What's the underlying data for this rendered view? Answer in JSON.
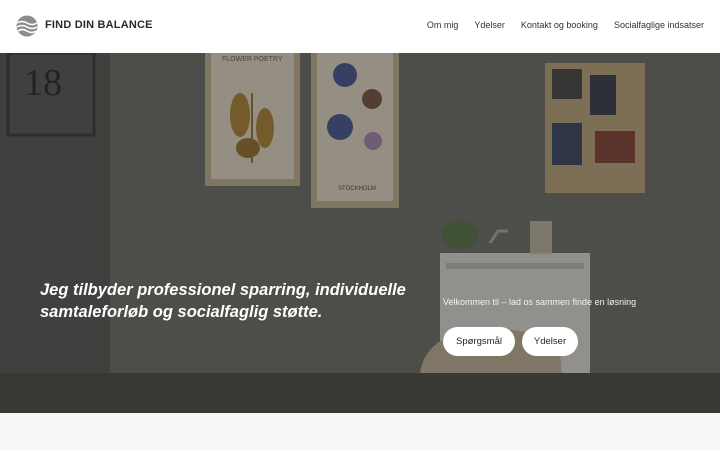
{
  "header": {
    "brand": "FIND DIN BALANCE",
    "nav": [
      "Om mig",
      "Ydelser",
      "Kontakt og booking",
      "Socialfaglige indsatser"
    ]
  },
  "hero": {
    "headline": "Jeg tilbyder professionel sparring, individuelle samtaleforløb og socialfaglig støtte.",
    "welcome": "Velkommen til – lad os sammen finde en løsning",
    "buttons": {
      "questions": "Spørgsmål",
      "services": "Ydelser"
    },
    "poster_left_title": "FLOWER POETRY",
    "poster_right_title": "STOCKHOLM",
    "door_number": "18"
  },
  "colors": {
    "header_bg": "#ffffff",
    "hero_overlay": "#3f3f3c",
    "button_bg": "#ffffff",
    "text_light": "#ffffff"
  }
}
